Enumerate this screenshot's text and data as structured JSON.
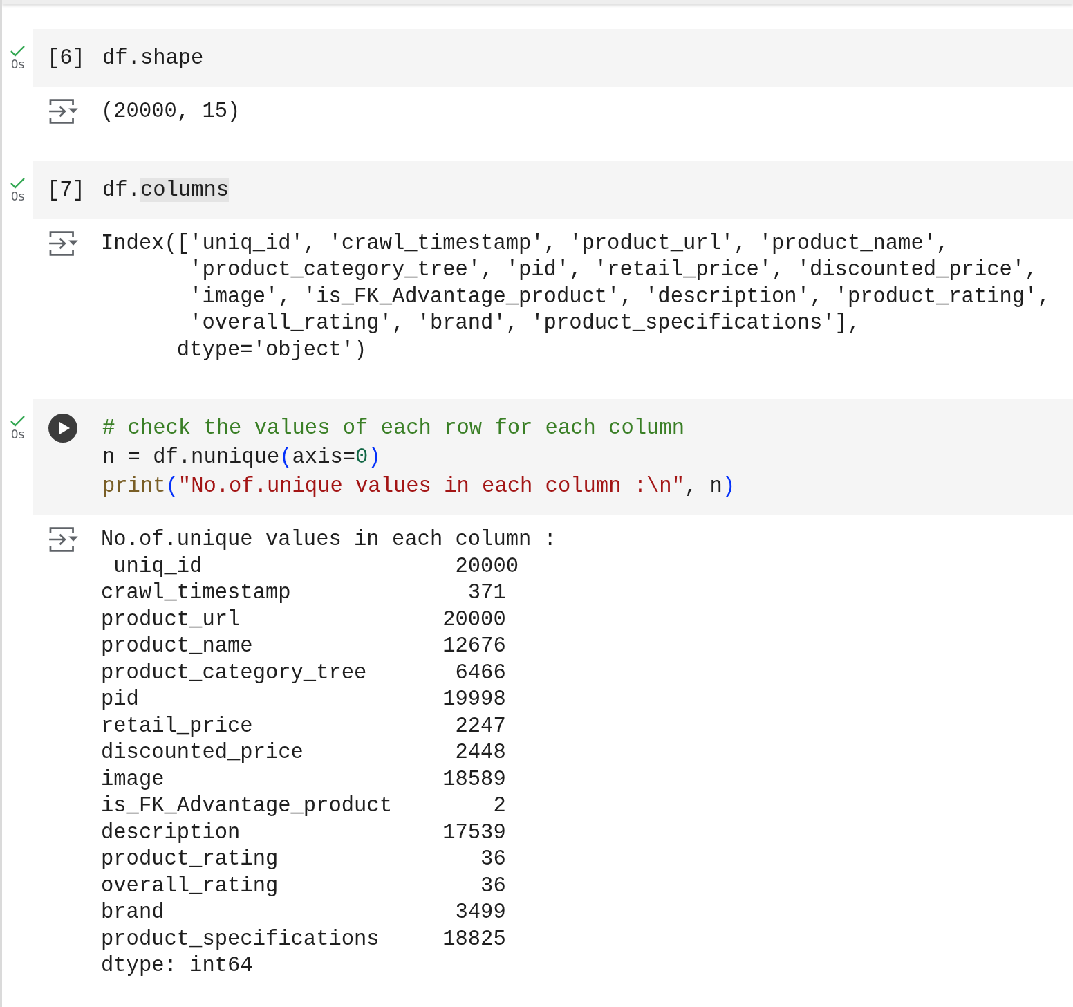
{
  "cells": [
    {
      "succeeded": true,
      "time": "0s",
      "gutter": {
        "kind": "count",
        "text": "[6]"
      },
      "code": [
        [
          {
            "kind": "plain",
            "text": "df.shape"
          }
        ]
      ],
      "output": [
        "(20000, 15)"
      ]
    },
    {
      "succeeded": true,
      "time": "0s",
      "gutter": {
        "kind": "count",
        "text": "[7]"
      },
      "code": [
        [
          {
            "kind": "plain",
            "text": "df."
          },
          {
            "kind": "highlight",
            "text": "columns"
          }
        ]
      ],
      "output": [
        "Index(['uniq_id', 'crawl_timestamp', 'product_url', 'product_name',",
        "       'product_category_tree', 'pid', 'retail_price', 'discounted_price',",
        "       'image', 'is_FK_Advantage_product', 'description', 'product_rating',",
        "       'overall_rating', 'brand', 'product_specifications'],",
        "      dtype='object')"
      ]
    },
    {
      "succeeded": true,
      "time": "0s",
      "gutter": {
        "kind": "run"
      },
      "code": [
        [
          {
            "kind": "comment",
            "text": "# check the values of each row for each column"
          }
        ],
        [
          {
            "kind": "plain",
            "text": "n = df.nunique"
          },
          {
            "kind": "paren",
            "text": "("
          },
          {
            "kind": "plain",
            "text": "axis="
          },
          {
            "kind": "number",
            "text": "0"
          },
          {
            "kind": "paren",
            "text": ")"
          }
        ],
        [
          {
            "kind": "func",
            "text": "print"
          },
          {
            "kind": "paren",
            "text": "("
          },
          {
            "kind": "string",
            "text": "\"No.of.unique values in each column :\\n\""
          },
          {
            "kind": "plain",
            "text": ", n"
          },
          {
            "kind": "paren",
            "text": ")"
          }
        ]
      ],
      "output": [
        "No.of.unique values in each column :",
        " uniq_id                    20000",
        "crawl_timestamp              371",
        "product_url                20000",
        "product_name               12676",
        "product_category_tree       6466",
        "pid                        19998",
        "retail_price                2247",
        "discounted_price            2448",
        "image                      18589",
        "is_FK_Advantage_product        2",
        "description                17539",
        "product_rating                36",
        "overall_rating                36",
        "brand                       3499",
        "product_specifications     18825",
        "dtype: int64"
      ]
    }
  ]
}
